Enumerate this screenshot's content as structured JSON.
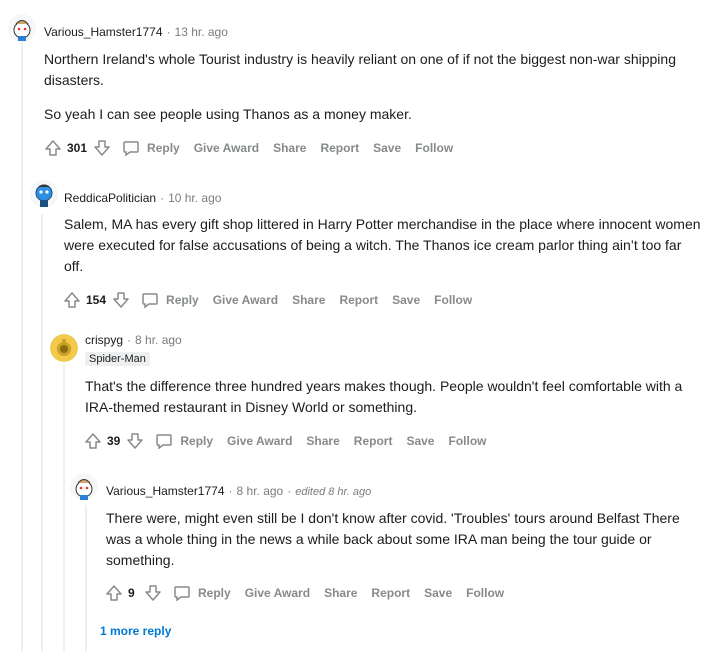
{
  "actions": {
    "reply": "Reply",
    "give_award": "Give Award",
    "share": "Share",
    "report": "Report",
    "save": "Save",
    "follow": "Follow"
  },
  "comments": [
    {
      "author": "Various_Hamster1774",
      "time": "13 hr. ago",
      "paragraphs": [
        "Northern Ireland's whole Tourist industry is heavily reliant on one of if not the biggest non-war shipping disasters.",
        "So yeah I can see people using Thanos as a money maker."
      ],
      "score": "301",
      "avatar_icon": "snoo-avatar-icon"
    },
    {
      "author": "ReddicaPolitician",
      "time": "10 hr. ago",
      "paragraphs": [
        "Salem, MA has every gift shop littered in Harry Potter merchandise in the place where innocent women were executed for false accusations of being a witch. The Thanos ice cream parlor thing ain’t too far off."
      ],
      "score": "154",
      "avatar_icon": "snoo-avatar-blue-icon"
    },
    {
      "author": "crispyg",
      "time": "8 hr. ago",
      "flair": "Spider-Man",
      "paragraphs": [
        "That's the difference three hundred years makes though. People wouldn't feel comfortable with a IRA-themed restaurant in Disney World or something."
      ],
      "score": "39",
      "avatar_icon": "snoo-avatar-yellow-icon"
    },
    {
      "author": "Various_Hamster1774",
      "time": "8 hr. ago",
      "edited": "edited 8 hr. ago",
      "paragraphs": [
        "There were, might even still be I don't know after covid. 'Troubles' tours around Belfast There was a whole thing in the news a while back about some IRA man being the tour guide or something."
      ],
      "score": "9",
      "avatar_icon": "snoo-avatar-icon"
    }
  ],
  "more_replies": "1 more reply",
  "colors": {
    "text": "#1c1c1c",
    "meta": "#7c7c7c",
    "action": "#878a8c",
    "link": "#0079d3",
    "thread_line": "#edeff1"
  }
}
